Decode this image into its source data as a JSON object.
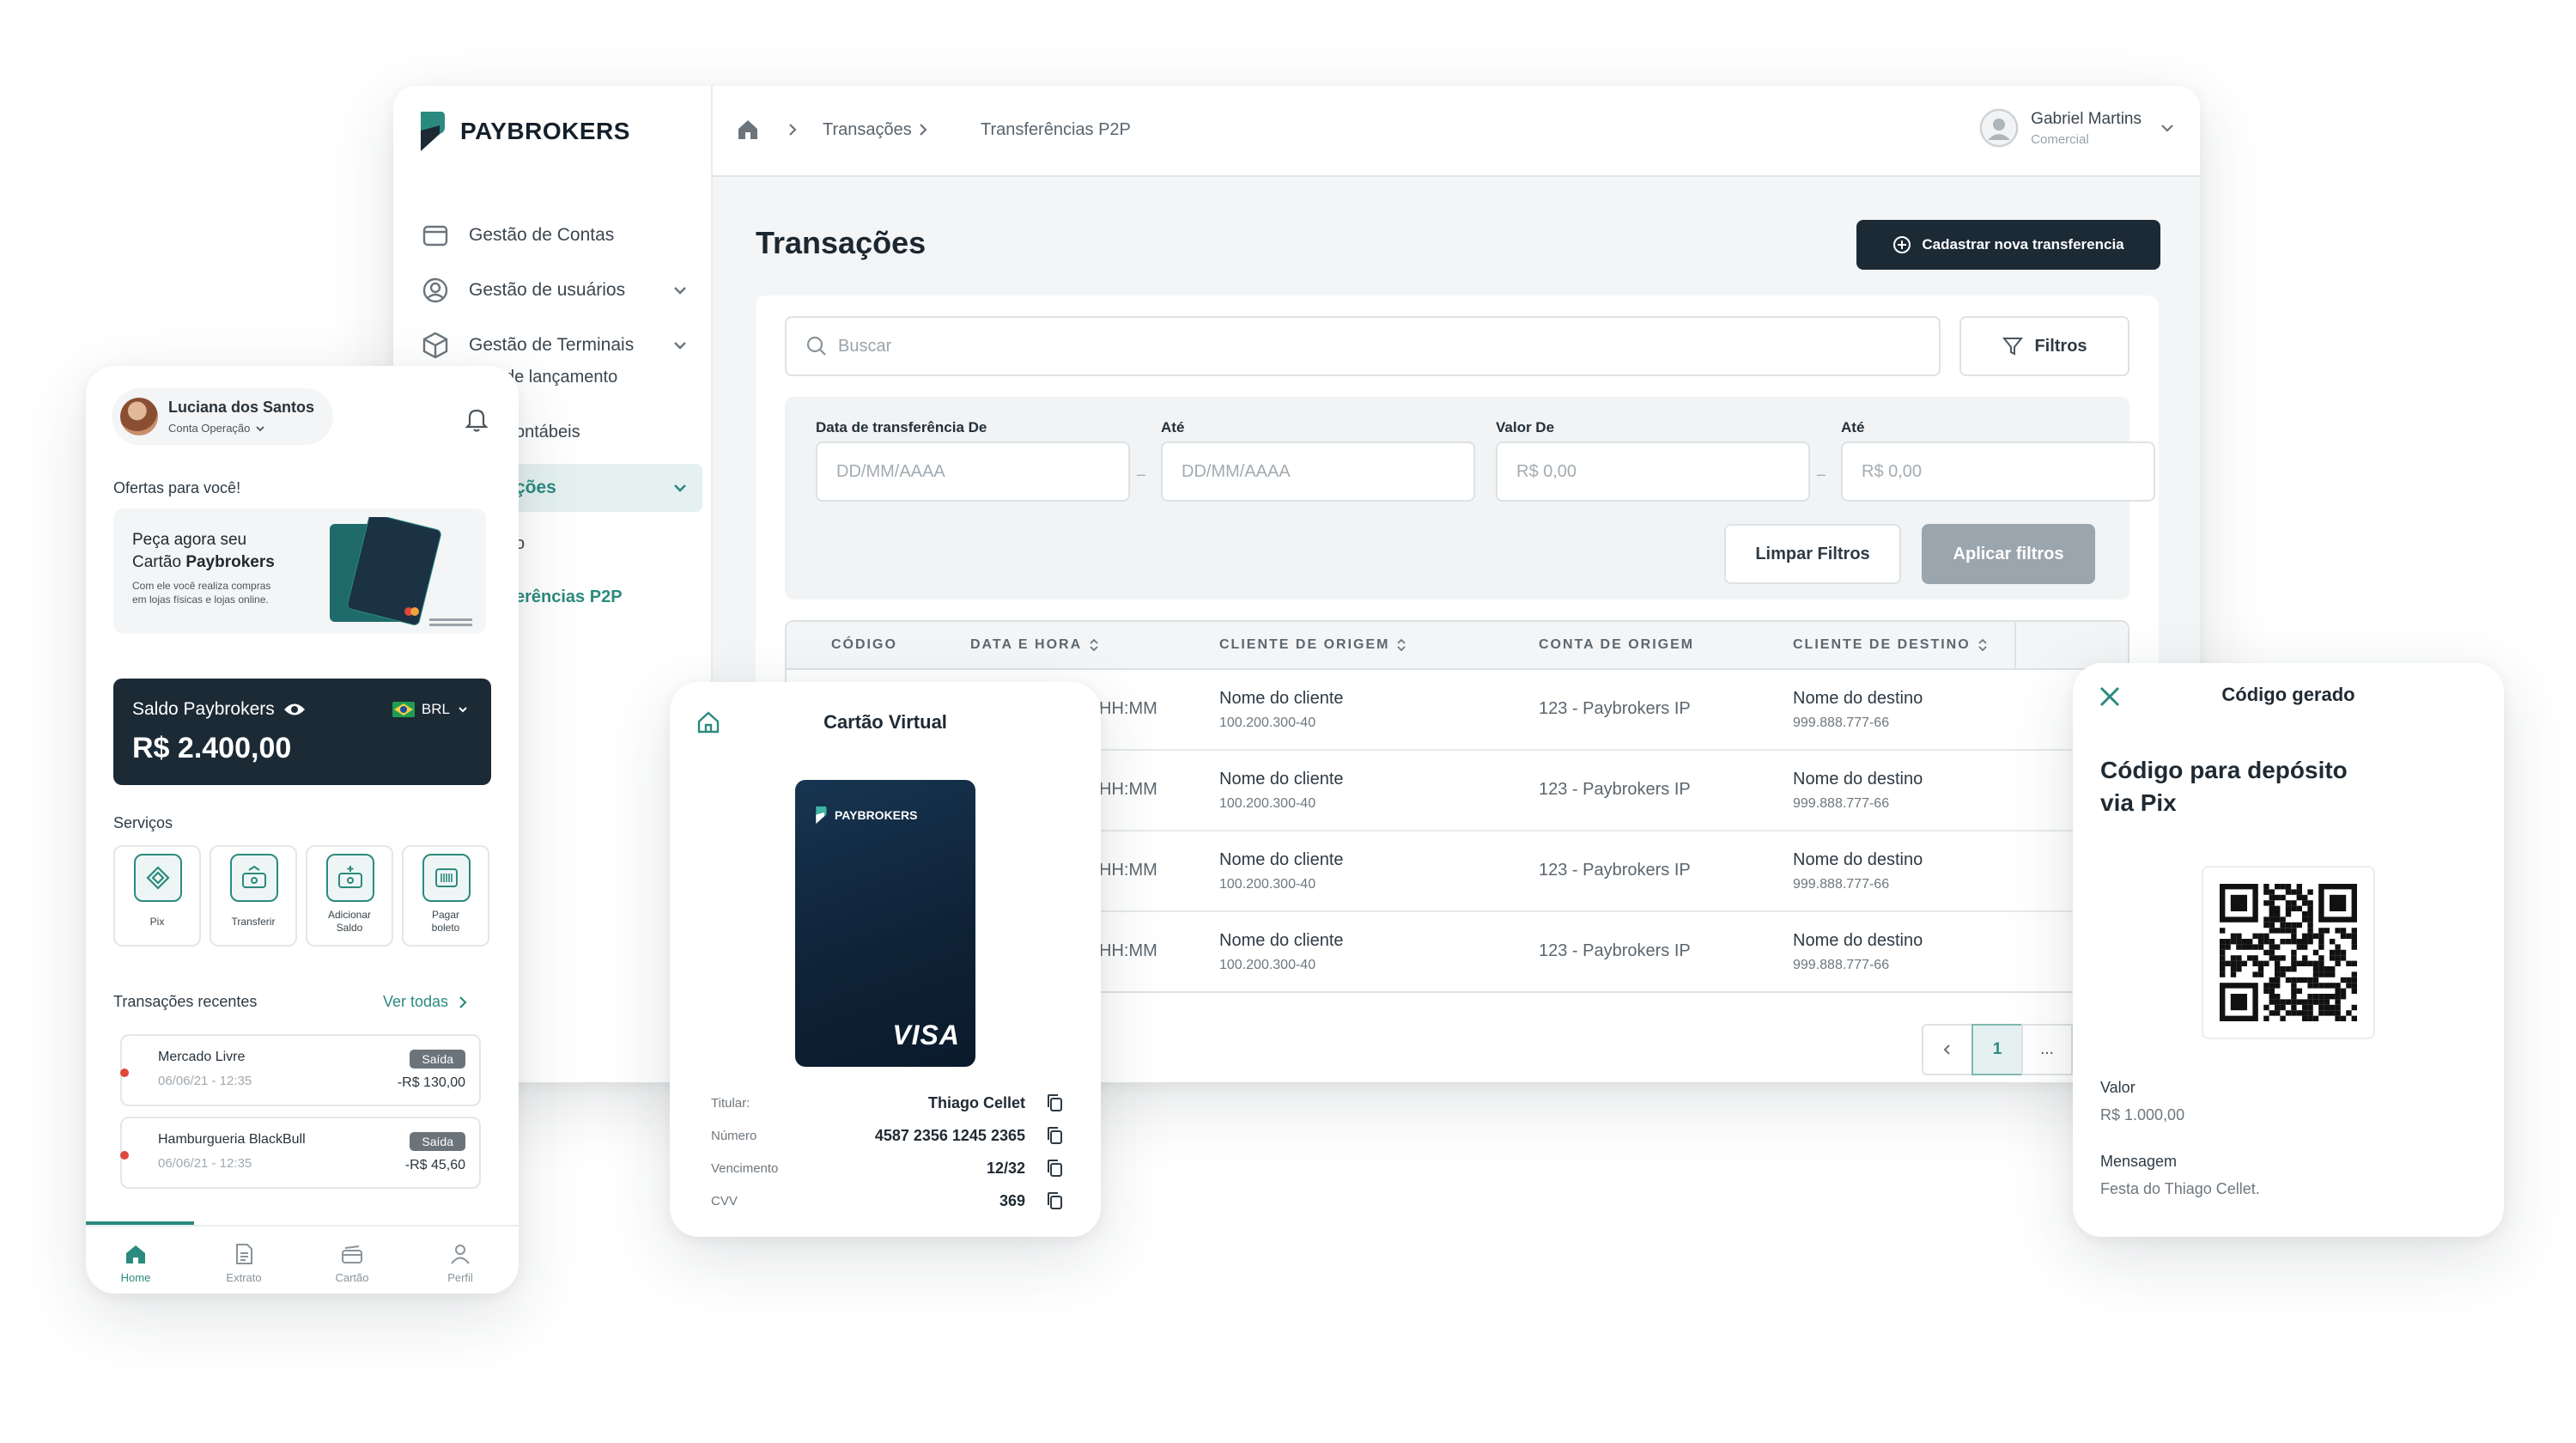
{
  "colors": {
    "primary": "#1c2a36",
    "accent": "#2b8a7e",
    "accent_light": "#e5f1f0",
    "danger": "#e0473b"
  },
  "desktop": {
    "brand": "PAYBROKERS",
    "sidebar": {
      "items": [
        {
          "label": "Gestão de Contas",
          "icon": "card-icon"
        },
        {
          "label": "Gestão de usuários",
          "icon": "user-circle-icon"
        },
        {
          "label": "Gestão de Terminais",
          "icon": "box-icon"
        },
        {
          "label": "de lançamento",
          "icon": ""
        },
        {
          "label": "ontábeis",
          "icon": ""
        },
        {
          "label": "ções",
          "icon": ""
        },
        {
          "label": "o",
          "icon": ""
        },
        {
          "label": "erências P2P",
          "icon": ""
        }
      ]
    },
    "breadcrumb": {
      "home_icon": "home-icon",
      "level1": "Transações",
      "level2": "Transferências P2P"
    },
    "user": {
      "name": "Gabriel Martins",
      "role": "Comercial"
    },
    "page_title": "Transações",
    "new_transfer_button": "Cadastrar nova transferencia",
    "search_placeholder": "Buscar",
    "filters_button": "Filtros",
    "filter_form": {
      "date_from_label": "Data de transferência De",
      "date_to_label": "Até",
      "value_from_label": "Valor De",
      "value_to_label": "Até",
      "date_placeholder": "DD/MM/AAAA",
      "value_placeholder": "R$  0,00",
      "separator": "–",
      "clear_button": "Limpar Filtros",
      "apply_button": "Aplicar filtros"
    },
    "table": {
      "columns": [
        "CÓDIGO",
        "DATA E HORA",
        "CLIENTE DE ORIGEM",
        "CONTA DE ORIGEM",
        "CLIENTE DE DESTINO"
      ],
      "rows": [
        {
          "time": "HH:MM",
          "origin_client": "Nome do cliente",
          "origin_doc": "100.200.300-40",
          "origin_account": "123 - Paybrokers IP",
          "dest_client": "Nome do destino",
          "dest_doc": "999.888.777-66"
        },
        {
          "time": "HH:MM",
          "origin_client": "Nome do cliente",
          "origin_doc": "100.200.300-40",
          "origin_account": "123 - Paybrokers IP",
          "dest_client": "Nome do destino",
          "dest_doc": "999.888.777-66"
        },
        {
          "time": "HH:MM",
          "origin_client": "Nome do cliente",
          "origin_doc": "100.200.300-40",
          "origin_account": "123 - Paybrokers IP",
          "dest_client": "Nome do destino",
          "dest_doc": "999.888.777-66"
        },
        {
          "time": "HH:MM",
          "origin_client": "Nome do cliente",
          "origin_doc": "100.200.300-40",
          "origin_account": "123 - Paybrokers IP",
          "dest_client": "Nome do destino",
          "dest_doc": "999.888.777-66"
        }
      ]
    },
    "pagination": {
      "current": "1",
      "ellipsis": "..."
    }
  },
  "mobile": {
    "user_name": "Luciana dos Santos",
    "account": "Conta Operação",
    "offers_title": "Ofertas para você!",
    "promo": {
      "line1": "Peça agora seu",
      "line2_prefix": "Cartão ",
      "line2_bold": "Paybrokers",
      "desc1": "Com ele você realiza compras",
      "desc2": "em lojas físicas e lojas online."
    },
    "balance": {
      "title": "Saldo Paybrokers",
      "currency": "BRL",
      "value": "R$ 2.400,00"
    },
    "services_title": "Serviços",
    "services": [
      {
        "label": "Pix",
        "label2": ""
      },
      {
        "label": "Transferir",
        "label2": ""
      },
      {
        "label": "Adicionar",
        "label2": "Saldo"
      },
      {
        "label": "Pagar",
        "label2": "boleto"
      }
    ],
    "recent_title": "Transações recentes",
    "see_all": "Ver todas",
    "transactions": [
      {
        "name": "Mercado Livre",
        "date": "06/06/21 - 12:35",
        "badge": "Saída",
        "value": "-R$ 130,00"
      },
      {
        "name": "Hamburgueria BlackBull",
        "date": "06/06/21 - 12:35",
        "badge": "Saída",
        "value": "-R$ 45,60"
      }
    ],
    "tabs": [
      "Home",
      "Extrato",
      "Cartão",
      "Perfil"
    ]
  },
  "virtual_card": {
    "title": "Cartão Virtual",
    "card_brand": "PAYBROKERS",
    "network": "VISA",
    "fields": [
      {
        "label": "Titular:",
        "value": "Thiago Cellet"
      },
      {
        "label": "Número",
        "value": "4587 2356 1245 2365"
      },
      {
        "label": "Vencimento",
        "value": "12/32"
      },
      {
        "label": "CVV",
        "value": "369"
      }
    ]
  },
  "pix": {
    "title": "Código gerado",
    "heading_line1": "Código para depósito",
    "heading_line2": "via Pix",
    "value_label": "Valor",
    "value": "R$ 1.000,00",
    "message_label": "Mensagem",
    "message": "Festa do Thiago Cellet."
  }
}
